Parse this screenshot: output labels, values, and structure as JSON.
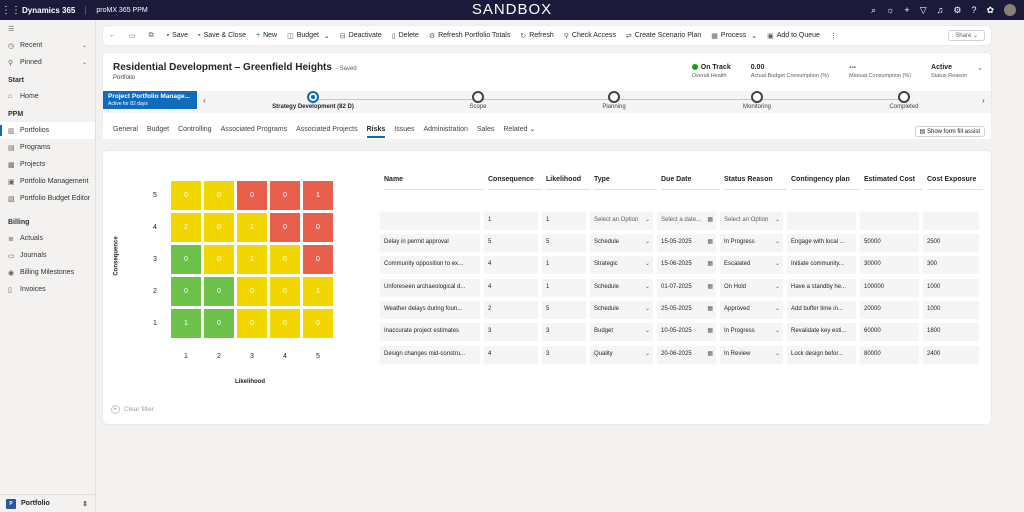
{
  "topbar": {
    "brand": "Dynamics 365",
    "app": "proMX 365 PPM",
    "environment": "SANDBOX",
    "icons": [
      "search-icon",
      "lightbulb-icon",
      "plus-icon",
      "filter-icon",
      "bell-icon",
      "gear-icon",
      "help-icon",
      "copilot-icon"
    ]
  },
  "sidebar": {
    "top_items": [
      {
        "label": "Recent",
        "icon": "clock-icon"
      },
      {
        "label": "Pinned",
        "icon": "pin-icon"
      }
    ],
    "sections": [
      {
        "title": "Start",
        "items": [
          {
            "label": "Home",
            "icon": "home-icon"
          }
        ]
      },
      {
        "title": "PPM",
        "items": [
          {
            "label": "Portfolios",
            "icon": "portfolio-icon",
            "active": true
          },
          {
            "label": "Programs",
            "icon": "program-icon"
          },
          {
            "label": "Projects",
            "icon": "project-icon"
          },
          {
            "label": "Portfolio Management",
            "icon": "management-icon"
          },
          {
            "label": "Portfolio Budget Editor",
            "icon": "budget-editor-icon"
          }
        ]
      },
      {
        "title": "Billing",
        "items": [
          {
            "label": "Actuals",
            "icon": "actuals-icon"
          },
          {
            "label": "Journals",
            "icon": "journal-icon"
          },
          {
            "label": "Billing Milestones",
            "icon": "milestone-icon"
          },
          {
            "label": "Invoices",
            "icon": "invoice-icon"
          }
        ]
      }
    ],
    "area_switcher": {
      "badge": "P",
      "label": "Portfolio"
    }
  },
  "commandbar": {
    "items": [
      {
        "label": "Save",
        "icon": "save-icon"
      },
      {
        "label": "Save & Close",
        "icon": "save-close-icon"
      },
      {
        "label": "New",
        "icon": "plus-icon"
      },
      {
        "label": "Budget",
        "icon": "budget-icon",
        "dropdown": true
      },
      {
        "label": "Deactivate",
        "icon": "deactivate-icon"
      },
      {
        "label": "Delete",
        "icon": "delete-icon"
      },
      {
        "label": "Refresh Portfolio Totals",
        "icon": "refresh-totals-icon"
      },
      {
        "label": "Refresh",
        "icon": "refresh-icon"
      },
      {
        "label": "Check Access",
        "icon": "check-access-icon"
      },
      {
        "label": "Create Scenario Plan",
        "icon": "scenario-icon"
      },
      {
        "label": "Process",
        "icon": "process-icon",
        "dropdown": true
      },
      {
        "label": "Add to Queue",
        "icon": "queue-icon"
      }
    ],
    "more": "⋮",
    "share": "Share"
  },
  "header": {
    "title": "Residential Development – Greenfield Heights",
    "saved": "- Saved",
    "entity": "Portfolio",
    "fields": [
      {
        "value": "On Track",
        "label": "Overall Health",
        "dot": "#13a10e"
      },
      {
        "value": "0.00",
        "label": "Actual Budget Consumption (%)"
      },
      {
        "value": "---",
        "label": "Manual Consumption (%)"
      },
      {
        "value": "Active",
        "label": "Status Reason"
      }
    ]
  },
  "bpf": {
    "process_name": "Project Portfolio Manage...",
    "duration": "Active for 82 days",
    "stages": [
      {
        "label": "Strategy Development  (82 D)",
        "active": true
      },
      {
        "label": "Scope"
      },
      {
        "label": "Planning"
      },
      {
        "label": "Monitoring"
      },
      {
        "label": "Completed"
      }
    ]
  },
  "tabs": {
    "items": [
      "General",
      "Budget",
      "Controlling",
      "Associated Programs",
      "Associated Projects",
      "Risks",
      "Issues",
      "Administration",
      "Sales",
      "Related"
    ],
    "active": "Risks",
    "form_fill": "Show form fill assist"
  },
  "risk_matrix": {
    "y_axis_label": "Consequence",
    "x_axis_label": "Likelihood",
    "row_labels": [
      "5",
      "4",
      "3",
      "2",
      "1"
    ],
    "col_labels": [
      "1",
      "2",
      "3",
      "4",
      "5"
    ],
    "counts": [
      [
        "0",
        "0",
        "0",
        "0",
        "1"
      ],
      [
        "2",
        "0",
        "1",
        "0",
        "0"
      ],
      [
        "0",
        "0",
        "1",
        "0",
        "0"
      ],
      [
        "0",
        "0",
        "0",
        "0",
        "1"
      ],
      [
        "1",
        "0",
        "0",
        "0",
        "0"
      ]
    ],
    "colors": [
      [
        "#f2d600",
        "#f2d600",
        "#e8604c",
        "#e8604c",
        "#e8604c"
      ],
      [
        "#f2d600",
        "#f2d600",
        "#f2d600",
        "#e8604c",
        "#e8604c"
      ],
      [
        "#6cc24a",
        "#f2d600",
        "#f2d600",
        "#f2d600",
        "#e8604c"
      ],
      [
        "#6cc24a",
        "#6cc24a",
        "#f2d600",
        "#f2d600",
        "#f2d600"
      ],
      [
        "#6cc24a",
        "#6cc24a",
        "#f2d600",
        "#f2d600",
        "#f2d600"
      ]
    ],
    "clear_filter": "Clear filter"
  },
  "risks_grid": {
    "columns": [
      "Name",
      "Consequence",
      "Likelihood",
      "Type",
      "Due Date",
      "Status Reason",
      "Contingency plan",
      "Estimated Cost",
      "Cost Exposure"
    ],
    "filter_row": [
      "",
      "1",
      "1",
      "Select an Option",
      "Select a date...",
      "Select an Option",
      "",
      "",
      ""
    ],
    "rows": [
      [
        "Delay in permit approval",
        "5",
        "5",
        "Schedule",
        "15-05-2025",
        "In Progress",
        "Engage with local ...",
        "50000",
        "2500"
      ],
      [
        "Community opposition to ex...",
        "4",
        "1",
        "Strategic",
        "15-06-2025",
        "Escalated",
        "Initiate community...",
        "30000",
        "300"
      ],
      [
        "Unforeseen archaeological d...",
        "4",
        "1",
        "Schedule",
        "01-07-2025",
        "On Hold",
        "Have a standby he...",
        "100000",
        "1000"
      ],
      [
        "Weather delays during foun...",
        "2",
        "5",
        "Schedule",
        "25-05-2025",
        "Approved",
        "Add buffer time in...",
        "20000",
        "1000"
      ],
      [
        "Inaccurate project estimates",
        "3",
        "3",
        "Budget",
        "10-05-2025",
        "In Progress",
        "Revalidate key esti...",
        "60000",
        "1800"
      ],
      [
        "Design changes mid-constru...",
        "4",
        "3",
        "Quality",
        "20-06-2025",
        "In Review",
        "Lock design befor...",
        "80000",
        "2400"
      ]
    ]
  }
}
